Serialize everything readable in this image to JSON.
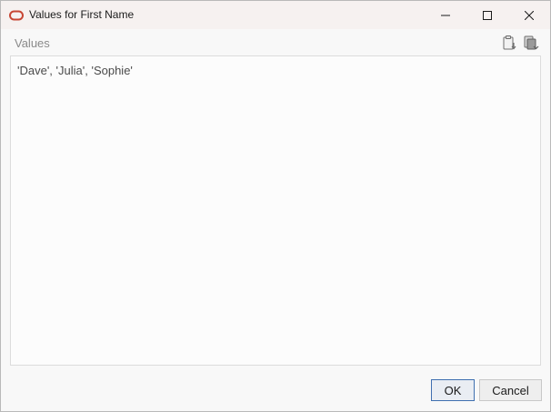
{
  "window": {
    "title": "Values for First Name",
    "app_icon": "oracle-ring-icon",
    "controls": {
      "minimize": "minimize-icon",
      "maximize": "maximize-icon",
      "close": "close-icon"
    }
  },
  "values_section": {
    "label": "Values",
    "tools": [
      "paste-clipboard-icon",
      "copy-clipboard-icon"
    ],
    "content": "'Dave', 'Julia', 'Sophie'"
  },
  "buttons": {
    "ok": "OK",
    "cancel": "Cancel"
  },
  "colors": {
    "app_icon": "#c74634",
    "titlebar": "#f6f1f0",
    "ok_border": "#3f6fb0"
  }
}
